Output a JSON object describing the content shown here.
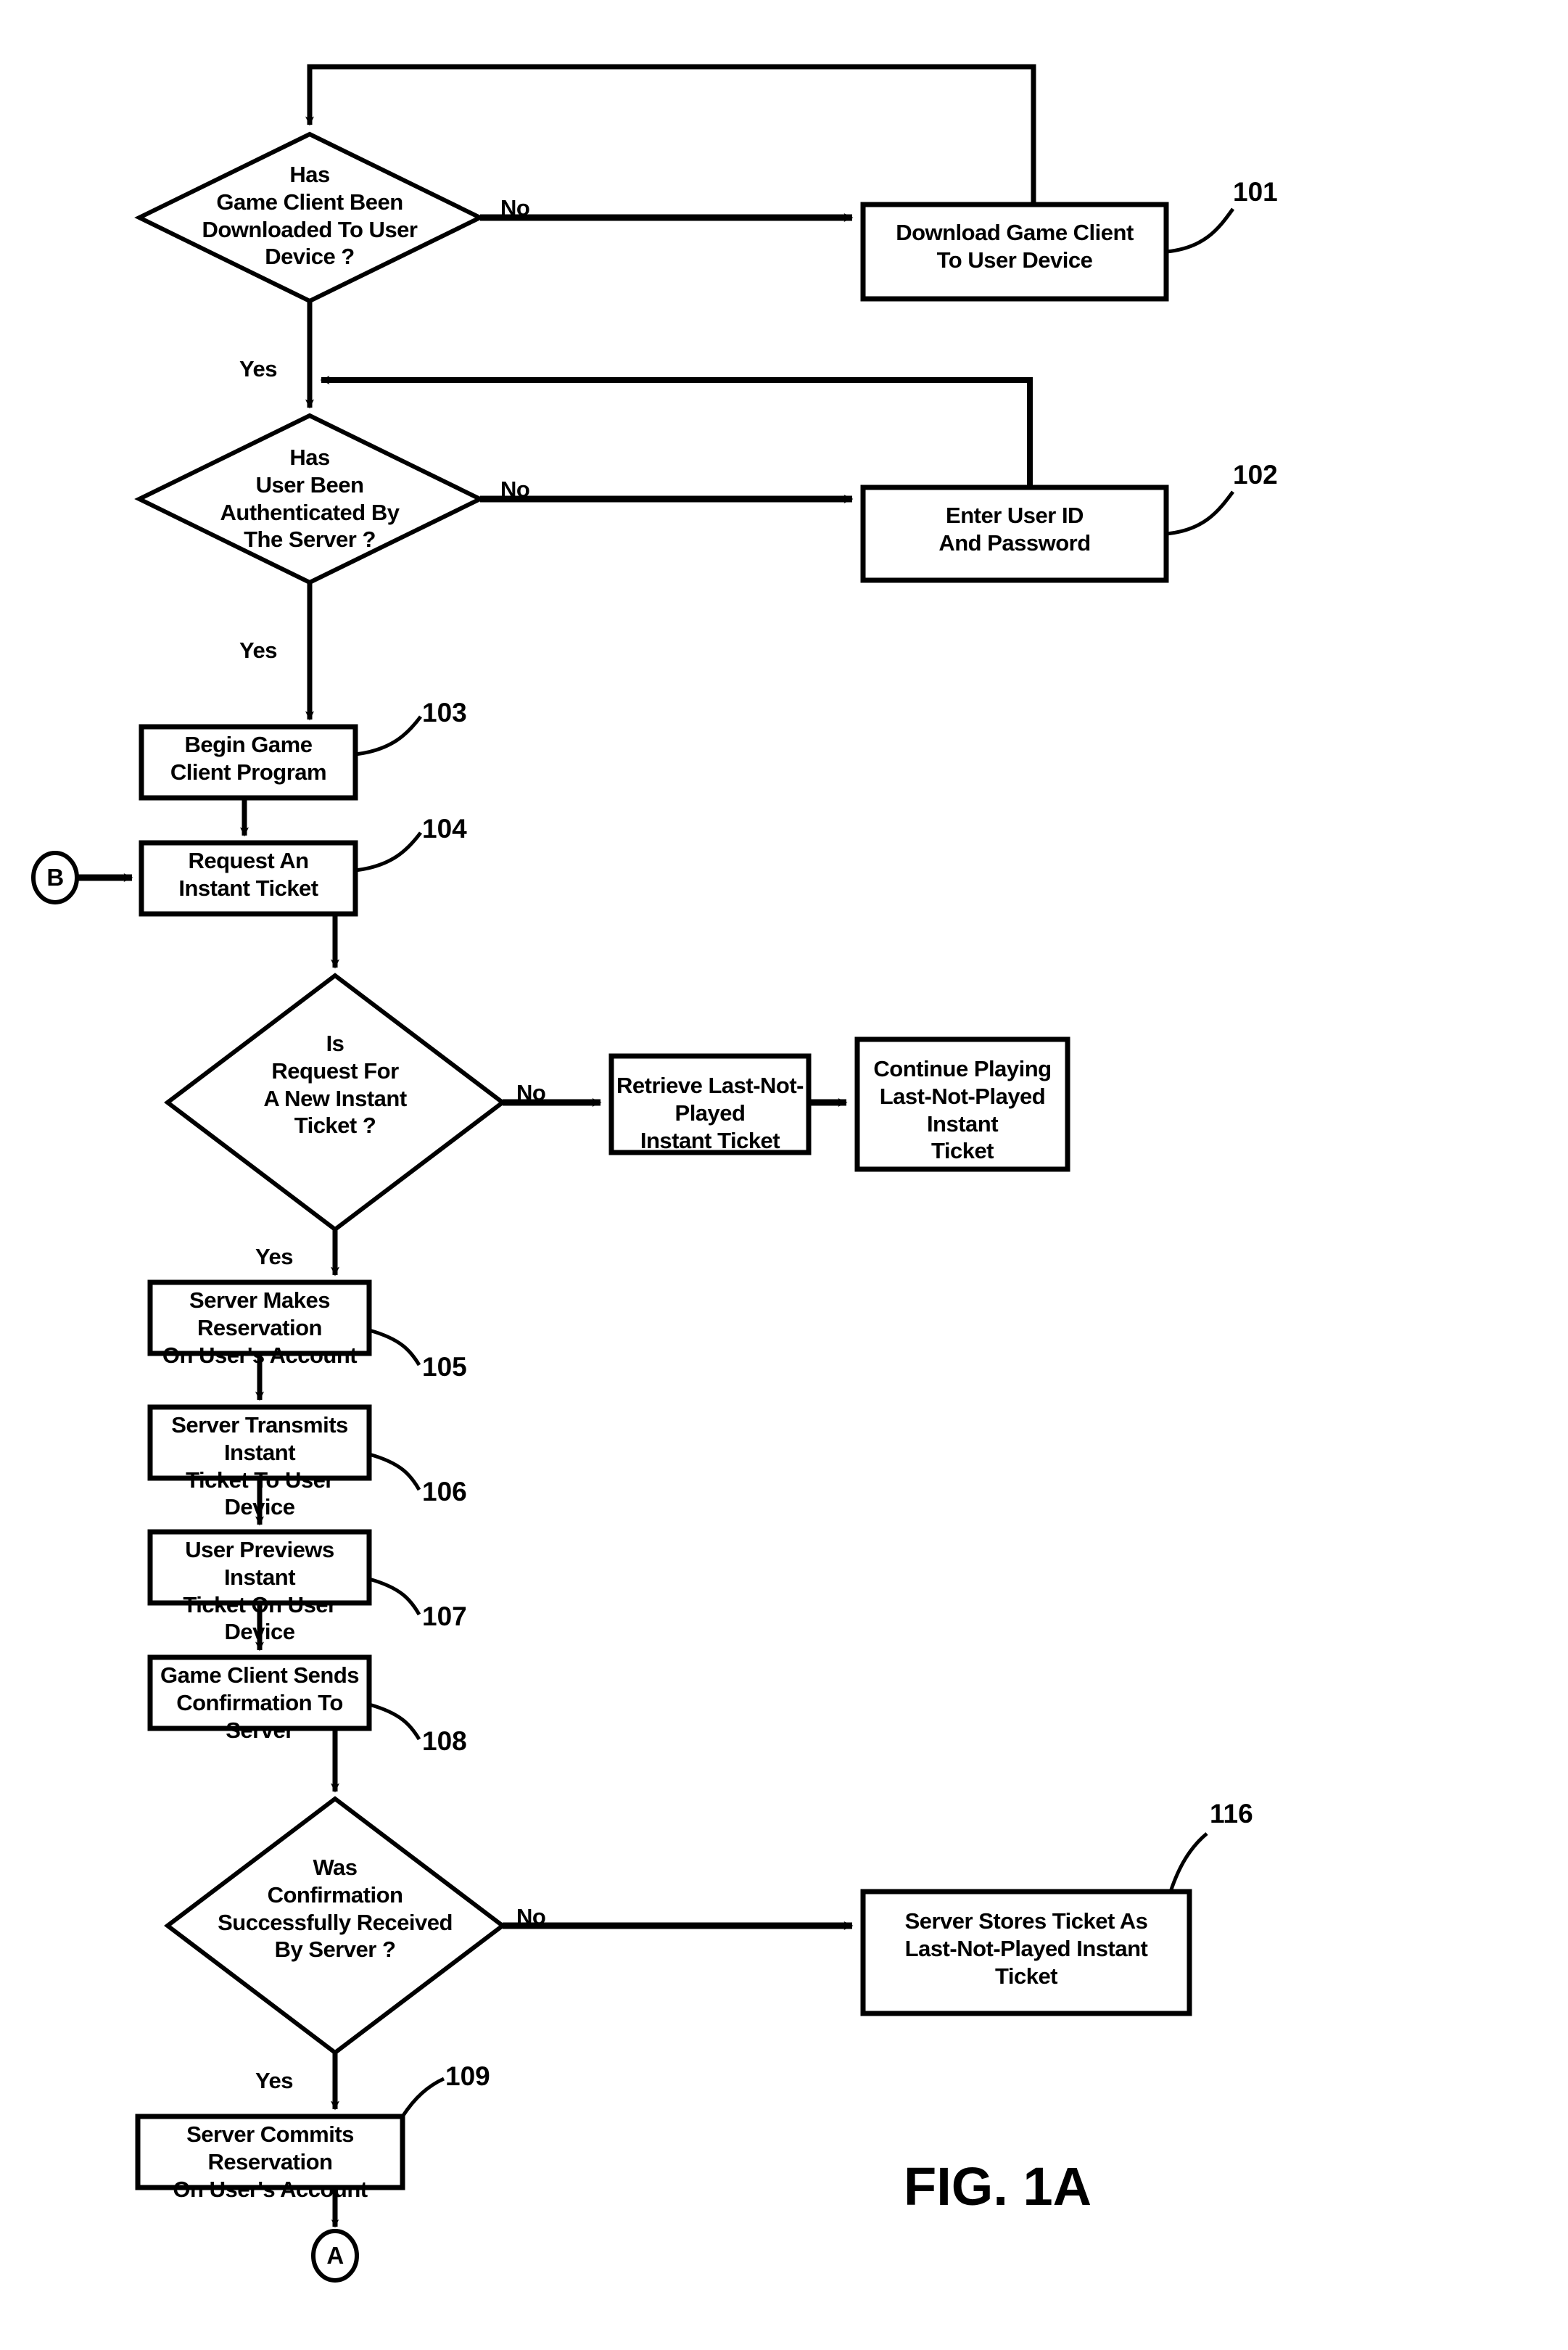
{
  "figure": {
    "caption": "FIG. 1A",
    "type": "flowchart"
  },
  "chart_data": {
    "type": "flowchart",
    "title": "FIG. 1A",
    "nodes": [
      {
        "id": "d1",
        "shape": "decision",
        "ref": null,
        "text": "Has\nGame Client Been\nDownloaded To User\nDevice ?"
      },
      {
        "id": "101",
        "shape": "process",
        "ref": "101",
        "text": "Download Game Client\nTo User Device"
      },
      {
        "id": "d2",
        "shape": "decision",
        "ref": null,
        "text": "Has\nUser Been\nAuthenticated By\nThe Server ?"
      },
      {
        "id": "102",
        "shape": "process",
        "ref": "102",
        "text": "Enter User ID\nAnd Password"
      },
      {
        "id": "103",
        "shape": "process",
        "ref": "103",
        "text": "Begin Game\nClient Program"
      },
      {
        "id": "104",
        "shape": "process",
        "ref": "104",
        "text": "Request An\nInstant Ticket"
      },
      {
        "id": "B",
        "shape": "connector",
        "ref": null,
        "text": "B"
      },
      {
        "id": "d3",
        "shape": "decision",
        "ref": null,
        "text": "Is\nRequest For\nA New Instant\nTicket ?"
      },
      {
        "id": "retrieve",
        "shape": "process",
        "ref": null,
        "text": "Retrieve Last-Not-Played\nInstant Ticket"
      },
      {
        "id": "continue",
        "shape": "process",
        "ref": null,
        "text": "Continue Playing\nLast-Not-Played Instant\nTicket"
      },
      {
        "id": "105",
        "shape": "process",
        "ref": "105",
        "text": "Server Makes Reservation\nOn User's Account"
      },
      {
        "id": "106",
        "shape": "process",
        "ref": "106",
        "text": "Server Transmits Instant\nTicket To User Device"
      },
      {
        "id": "107",
        "shape": "process",
        "ref": "107",
        "text": "User Previews Instant\nTicket On User Device"
      },
      {
        "id": "108",
        "shape": "process",
        "ref": "108",
        "text": "Game Client Sends\nConfirmation To Server"
      },
      {
        "id": "d4",
        "shape": "decision",
        "ref": null,
        "text": "Was\nConfirmation\nSuccessfully Received\nBy Server ?"
      },
      {
        "id": "116",
        "shape": "process",
        "ref": "116",
        "text": "Server Stores Ticket As\nLast-Not-Played Instant\nTicket"
      },
      {
        "id": "109",
        "shape": "process",
        "ref": "109",
        "text": "Server Commits Reservation\nOn User's Account"
      },
      {
        "id": "A",
        "shape": "connector",
        "ref": null,
        "text": "A"
      }
    ],
    "edges": [
      {
        "from": "d1",
        "to": "101",
        "label": "No"
      },
      {
        "from": "101",
        "to": "d1",
        "label": ""
      },
      {
        "from": "d1",
        "to": "d2",
        "label": "Yes"
      },
      {
        "from": "d2",
        "to": "102",
        "label": "No"
      },
      {
        "from": "102",
        "to": "d2",
        "label": ""
      },
      {
        "from": "d2",
        "to": "103",
        "label": "Yes"
      },
      {
        "from": "103",
        "to": "104",
        "label": ""
      },
      {
        "from": "B",
        "to": "104",
        "label": ""
      },
      {
        "from": "104",
        "to": "d3",
        "label": ""
      },
      {
        "from": "d3",
        "to": "retrieve",
        "label": "No"
      },
      {
        "from": "retrieve",
        "to": "continue",
        "label": ""
      },
      {
        "from": "d3",
        "to": "105",
        "label": "Yes"
      },
      {
        "from": "105",
        "to": "106",
        "label": ""
      },
      {
        "from": "106",
        "to": "107",
        "label": ""
      },
      {
        "from": "107",
        "to": "108",
        "label": ""
      },
      {
        "from": "108",
        "to": "d4",
        "label": ""
      },
      {
        "from": "d4",
        "to": "116",
        "label": "No"
      },
      {
        "from": "d4",
        "to": "109",
        "label": "Yes"
      },
      {
        "from": "109",
        "to": "A",
        "label": ""
      }
    ]
  },
  "nodes": {
    "d1": {
      "text": "Has\nGame Client Been\nDownloaded To User\nDevice ?"
    },
    "n101": {
      "text": "Download Game Client\nTo User Device",
      "ref": "101"
    },
    "d2": {
      "text": "Has\nUser Been\nAuthenticated By\nThe Server ?"
    },
    "n102": {
      "text": "Enter User ID\nAnd Password",
      "ref": "102"
    },
    "n103": {
      "text": "Begin Game\nClient Program",
      "ref": "103"
    },
    "n104": {
      "text": "Request An\nInstant Ticket",
      "ref": "104"
    },
    "connB": {
      "text": "B"
    },
    "d3": {
      "text": "Is\nRequest For\nA New Instant\nTicket ?"
    },
    "retrieve": {
      "text": "Retrieve Last-Not-Played\nInstant Ticket"
    },
    "continue": {
      "text": "Continue Playing\nLast-Not-Played Instant\nTicket"
    },
    "n105": {
      "text": "Server Makes Reservation\nOn User's Account",
      "ref": "105"
    },
    "n106": {
      "text": "Server Transmits Instant\nTicket To User Device",
      "ref": "106"
    },
    "n107": {
      "text": "User Previews Instant\nTicket On User Device",
      "ref": "107"
    },
    "n108": {
      "text": "Game Client Sends\nConfirmation To Server",
      "ref": "108"
    },
    "d4": {
      "text": "Was\nConfirmation\nSuccessfully Received\nBy Server ?"
    },
    "n116": {
      "text": "Server Stores Ticket As\nLast-Not-Played Instant\nTicket",
      "ref": "116"
    },
    "n109": {
      "text": "Server Commits Reservation\nOn User's Account",
      "ref": "109"
    },
    "connA": {
      "text": "A"
    }
  },
  "edge_labels": {
    "d1_no": "No",
    "d1_yes": "Yes",
    "d2_no": "No",
    "d2_yes": "Yes",
    "d3_no": "No",
    "d3_yes": "Yes",
    "d4_no": "No",
    "d4_yes": "Yes"
  },
  "colors": {
    "ink": "#000000",
    "paper": "#ffffff"
  }
}
